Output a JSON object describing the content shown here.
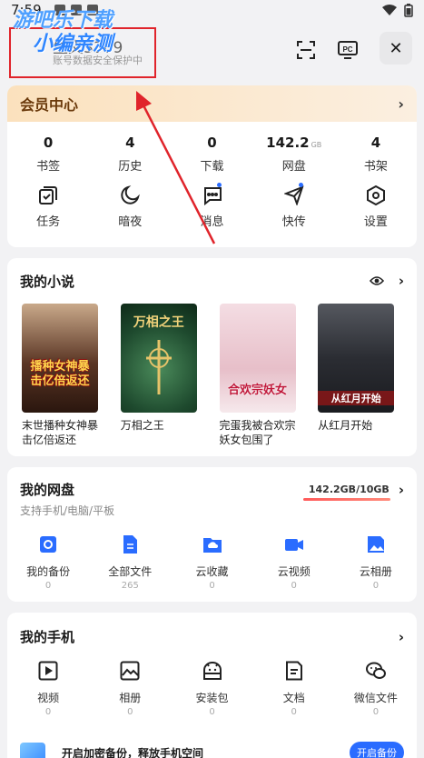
{
  "status_bar": {
    "time": "7:59"
  },
  "watermark": {
    "line1": "游吧乐下载",
    "line2": "小编亲测"
  },
  "user": {
    "name": "生义3389",
    "subtitle": "账号数据安全保护中"
  },
  "header": {
    "scan_icon": "scan-icon",
    "pc_label": "PC",
    "close_label": "✕"
  },
  "vip": {
    "title": "会员中心"
  },
  "stats": [
    {
      "value": "0",
      "unit": "",
      "label": "书签"
    },
    {
      "value": "4",
      "unit": "",
      "label": "历史"
    },
    {
      "value": "0",
      "unit": "",
      "label": "下载"
    },
    {
      "value": "142.2",
      "unit": "GB",
      "label": "网盘"
    },
    {
      "value": "4",
      "unit": "",
      "label": "书架"
    }
  ],
  "tools": [
    {
      "label": "任务",
      "icon": "task-icon",
      "dot": false
    },
    {
      "label": "暗夜",
      "icon": "moon-icon",
      "dot": false
    },
    {
      "label": "消息",
      "icon": "message-icon",
      "dot": true
    },
    {
      "label": "快传",
      "icon": "send-icon",
      "dot": true
    },
    {
      "label": "设置",
      "icon": "settings-icon",
      "dot": false
    }
  ],
  "novels": {
    "title": "我的小说",
    "books": [
      {
        "name": "末世播种女神暴击亿倍返还",
        "cover_text": "播种女神暴击亿倍返还",
        "cover_color": "#3a2218",
        "text_color": "#ffd34d"
      },
      {
        "name": "万相之王",
        "cover_text": "万相之王",
        "cover_color": "#1e4a2e",
        "text_color": "#f1d27a"
      },
      {
        "name": "完蛋我被合欢宗妖女包围了",
        "cover_text": "合欢宗妖女",
        "cover_color": "#e9c6cf",
        "text_color": "#c0183a"
      },
      {
        "name": "从红月开始",
        "cover_text": "从红月开始",
        "cover_color": "#2b2d33",
        "text_color": "#ffffff"
      }
    ]
  },
  "disk": {
    "title": "我的网盘",
    "usage": "142.2GB/10GB",
    "subtitle": "支持手机/电脑/平板",
    "items": [
      {
        "label": "我的备份",
        "count": "0",
        "icon": "backup-icon"
      },
      {
        "label": "全部文件",
        "count": "265",
        "icon": "file-icon"
      },
      {
        "label": "云收藏",
        "count": "0",
        "icon": "cloud-folder-icon"
      },
      {
        "label": "云视频",
        "count": "0",
        "icon": "video-icon"
      },
      {
        "label": "云相册",
        "count": "0",
        "icon": "album-icon"
      }
    ]
  },
  "phone": {
    "title": "我的手机",
    "items": [
      {
        "label": "视频",
        "count": "0",
        "icon": "play-icon"
      },
      {
        "label": "相册",
        "count": "0",
        "icon": "image-icon"
      },
      {
        "label": "安装包",
        "count": "0",
        "icon": "android-icon"
      },
      {
        "label": "文档",
        "count": "0",
        "icon": "document-icon"
      },
      {
        "label": "微信文件",
        "count": "0",
        "icon": "wechat-icon"
      }
    ],
    "encrypt_text": "开启加密备份，释放手机空间",
    "encrypt_button": "开启备份"
  },
  "colors": {
    "accent": "#2a6cff",
    "vip_gold": "#fbe1bd",
    "annotation_red": "#e0242b"
  }
}
